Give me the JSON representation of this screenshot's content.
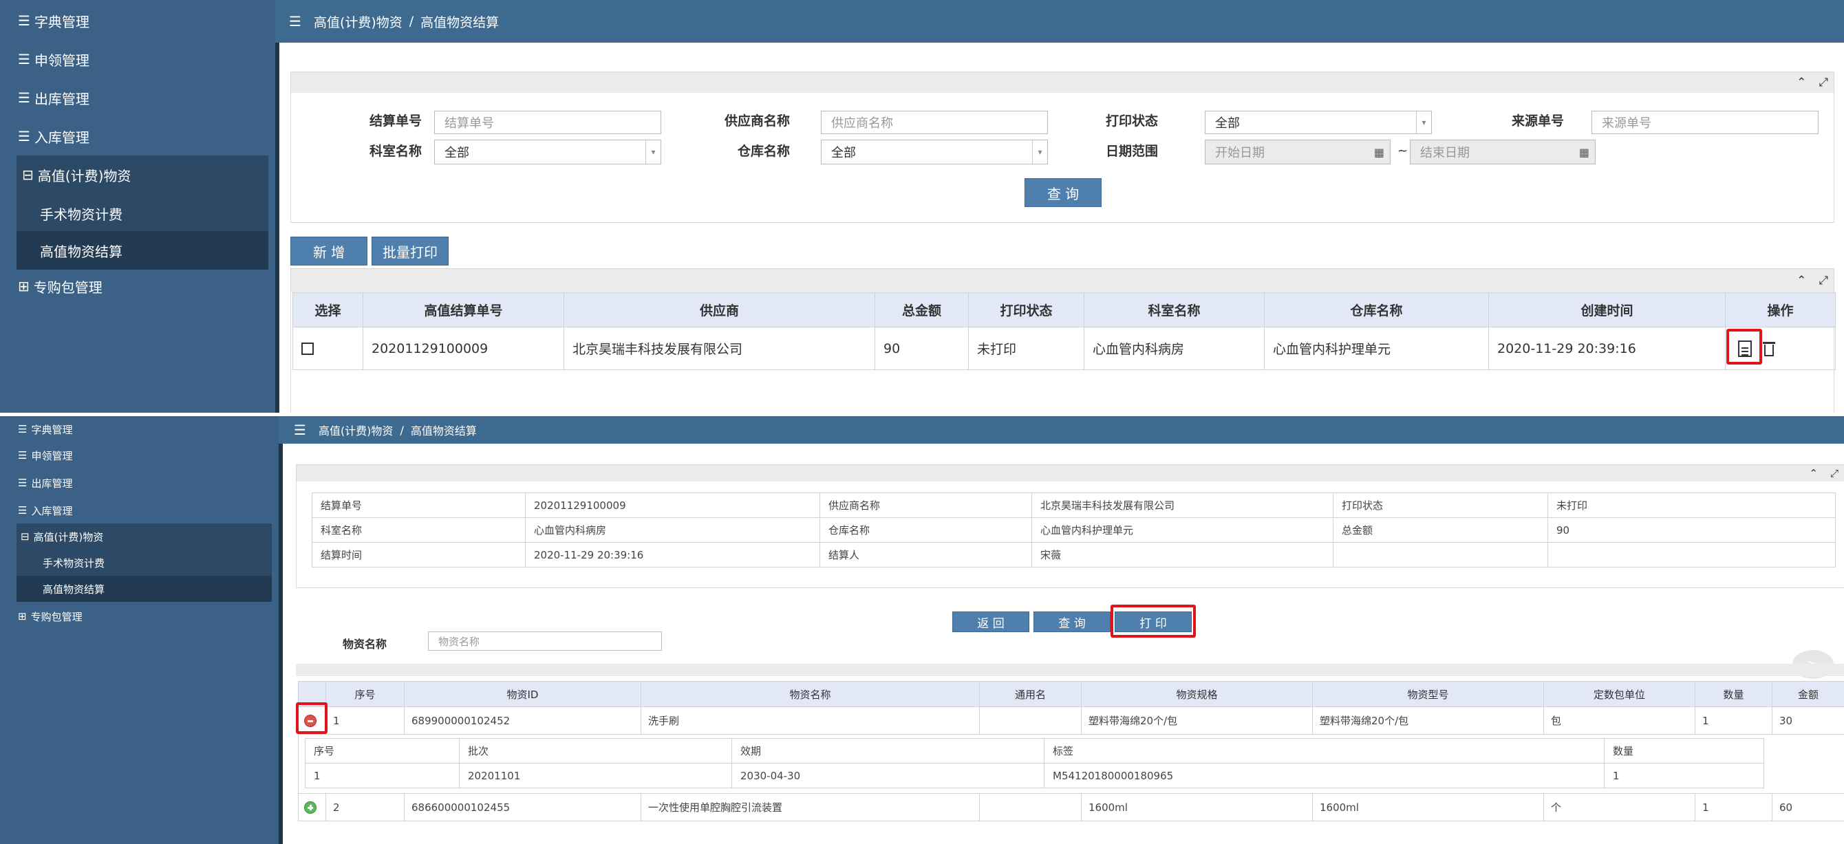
{
  "sidebar": {
    "items": [
      {
        "label": "字典管理"
      },
      {
        "label": "申领管理"
      },
      {
        "label": "出库管理"
      },
      {
        "label": "入库管理"
      },
      {
        "label": "高值(计费)物资"
      },
      {
        "label": "手术物资计费"
      },
      {
        "label": "高值物资结算"
      },
      {
        "label": "专购包管理"
      }
    ]
  },
  "breadcrumb": {
    "parent": "高值(计费)物资",
    "separator": "/",
    "current": "高值物资结算"
  },
  "filter": {
    "settlement_no_label": "结算单号",
    "settlement_no_placeholder": "结算单号",
    "supplier_label": "供应商名称",
    "supplier_placeholder": "供应商名称",
    "print_status_label": "打印状态",
    "print_status_value": "全部",
    "source_no_label": "来源单号",
    "source_no_placeholder": "来源单号",
    "dept_label": "科室名称",
    "dept_value": "全部",
    "warehouse_label": "仓库名称",
    "warehouse_value": "全部",
    "date_range_label": "日期范围",
    "start_date_placeholder": "开始日期",
    "date_sep": "~",
    "end_date_placeholder": "结束日期",
    "query_button": "查 询"
  },
  "toolbar": {
    "add_button": "新 增",
    "batch_print_button": "批量打印"
  },
  "list_table": {
    "headers": [
      "选择",
      "高值结算单号",
      "供应商",
      "总金额",
      "打印状态",
      "科室名称",
      "仓库名称",
      "创建时间",
      "操作"
    ],
    "rows": [
      {
        "no": "20201129100009",
        "supplier": "北京昊瑞丰科技发展有限公司",
        "total": "90",
        "print_status": "未打印",
        "dept": "心血管内科病房",
        "warehouse": "心血管内科护理单元",
        "created": "2020-11-29 20:39:16"
      }
    ]
  },
  "detail": {
    "info": [
      [
        "结算单号",
        "20201129100009",
        "供应商名称",
        "北京昊瑞丰科技发展有限公司",
        "打印状态",
        "未打印"
      ],
      [
        "科室名称",
        "心血管内科病房",
        "仓库名称",
        "心血管内科护理单元",
        "总金额",
        "90"
      ],
      [
        "结算时间",
        "2020-11-29 20:39:16",
        "结算人",
        "宋薇",
        "",
        ""
      ]
    ],
    "back_button": "返 回",
    "query_button": "查 询",
    "print_button": "打 印",
    "material_name_label": "物资名称",
    "material_name_placeholder": "物资名称",
    "float_button": ">",
    "table_headers": [
      "",
      "序号",
      "物资ID",
      "物资名称",
      "通用名",
      "物资规格",
      "物资型号",
      "定数包单位",
      "数量",
      "金额"
    ],
    "rows": [
      {
        "seq": "1",
        "id": "689900000102452",
        "name": "洗手刷",
        "generic": "",
        "spec": "塑料带海绵20个/包",
        "model": "塑料带海绵20个/包",
        "unit": "包",
        "qty": "1",
        "amount": "30"
      },
      {
        "seq": "2",
        "id": "686600000102455",
        "name": "一次性使用单腔胸腔引流装置",
        "generic": "",
        "spec": "1600ml",
        "model": "1600ml",
        "unit": "个",
        "qty": "1",
        "amount": "60"
      }
    ],
    "sub_headers": [
      "序号",
      "批次",
      "效期",
      "标签",
      "数量"
    ],
    "sub_rows": [
      {
        "seq": "1",
        "batch": "20201101",
        "expiry": "2030-04-30",
        "tag": "M54120180000180965",
        "qty": "1"
      }
    ]
  },
  "colors": {
    "sidebar": "#3b6286",
    "header": "#3e6a90",
    "button": "#4f7fac",
    "highlight": "#e2141b"
  }
}
